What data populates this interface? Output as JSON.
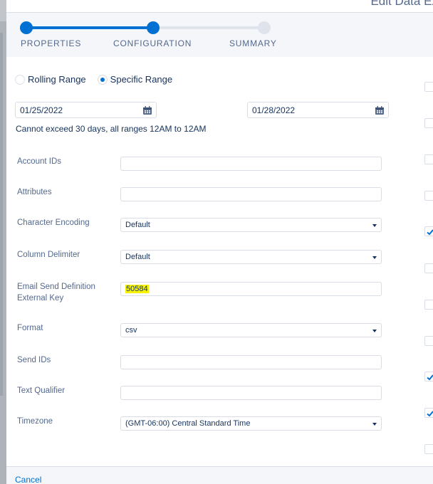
{
  "modal": {
    "title": "Edit Data Extract"
  },
  "steps": [
    {
      "label": "PROPERTIES",
      "state": "complete"
    },
    {
      "label": "CONFIGURATION",
      "state": "active"
    },
    {
      "label": "SUMMARY",
      "state": "incomplete"
    }
  ],
  "range": {
    "options": [
      {
        "label": "Rolling Range",
        "checked": false
      },
      {
        "label": "Specific Range",
        "checked": true
      }
    ],
    "start_date": "01/25/2022",
    "end_date": "01/28/2022",
    "hint": "Cannot exceed 30 days, all ranges 12AM to 12AM"
  },
  "fields": {
    "account_ids": {
      "label": "Account IDs",
      "value": ""
    },
    "attributes": {
      "label": "Attributes",
      "value": ""
    },
    "character_encoding": {
      "label": "Character Encoding",
      "value": "Default"
    },
    "column_delimiter": {
      "label": "Column Delimiter",
      "value": "Default"
    },
    "email_send_definition_key": {
      "label_line1": "Email Send Definition",
      "label_line2": "External Key",
      "value": "50584"
    },
    "format": {
      "label": "Format",
      "value": "csv"
    },
    "send_ids": {
      "label": "Send IDs",
      "value": ""
    },
    "text_qualifier": {
      "label": "Text Qualifier",
      "value": ""
    },
    "timezone": {
      "label": "Timezone",
      "value": "(GMT-06:00) Central Standard Time"
    }
  },
  "right_checkboxes": [
    false,
    false,
    false,
    false,
    true,
    false,
    false,
    false,
    true,
    true,
    false
  ],
  "colors": {
    "accent": "#0070d2",
    "highlight": "#f7f303",
    "step_incomplete": "#dfe3ec"
  },
  "footer": {
    "cancel_label": "Cancel"
  }
}
